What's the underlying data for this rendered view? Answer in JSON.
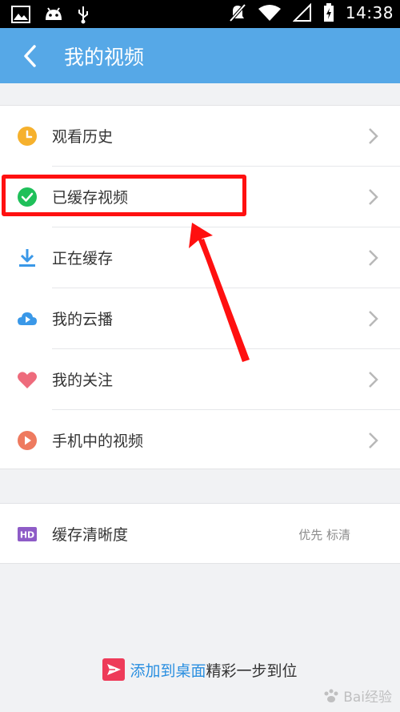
{
  "status_bar": {
    "time": "14:38",
    "icons": [
      "image-icon",
      "android-icon",
      "usb-icon",
      "mute-icon",
      "wifi-icon",
      "signal-icon",
      "battery-icon"
    ]
  },
  "app_bar": {
    "title": "我的视频",
    "back_icon": "back-arrow-icon"
  },
  "menu": {
    "items": [
      {
        "label": "观看历史",
        "icon": "clock-icon",
        "icon_color": "#f6b12d"
      },
      {
        "label": "已缓存视频",
        "icon": "check-circle-icon",
        "icon_color": "#1fc05a"
      },
      {
        "label": "正在缓存",
        "icon": "download-icon",
        "icon_color": "#3a98e8"
      },
      {
        "label": "我的云播",
        "icon": "cloud-play-icon",
        "icon_color": "#3a98e8"
      },
      {
        "label": "我的关注",
        "icon": "heart-icon",
        "icon_color": "#ee6b7c"
      },
      {
        "label": "手机中的视频",
        "icon": "play-circle-icon",
        "icon_color": "#ee7a5f"
      }
    ]
  },
  "settings": {
    "label": "缓存清晰度",
    "badge": "HD",
    "badge_color": "#8e5cc7",
    "value": "优先 标清"
  },
  "footer": {
    "link_text": "添加到桌面",
    "text": "精彩一步到位",
    "icon": "send-icon",
    "icon_color": "#ee3b59"
  },
  "annotation": {
    "color": "#ff1010"
  },
  "watermark": {
    "text": "Bai经验"
  }
}
